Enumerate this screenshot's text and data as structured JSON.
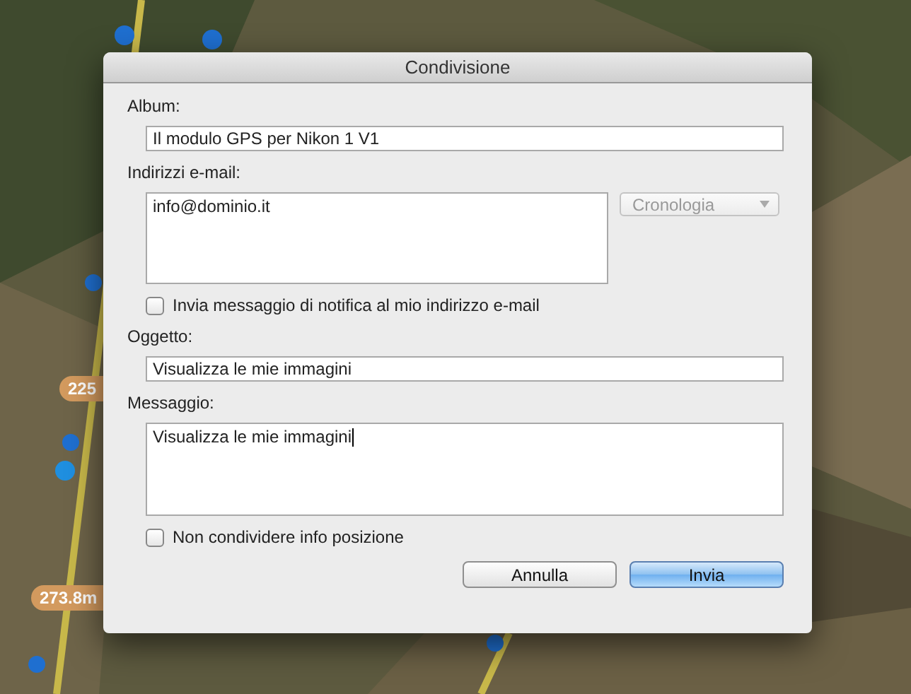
{
  "map": {
    "labels": [
      {
        "text": "225"
      },
      {
        "text": "273.8m"
      }
    ]
  },
  "dialog": {
    "title": "Condivisione",
    "sections": [
      {
        "kind": "line",
        "label": "Album:",
        "value": "Il modulo GPS per Nikon 1 V1",
        "focused": false
      },
      {
        "kind": "area",
        "label": "Indirizzi e-mail:",
        "value": "info@dominio.it",
        "focused": false,
        "dropdown": {
          "label": "Cronologia",
          "disabled": true
        }
      },
      {
        "kind": "checkbox",
        "label": "Invia messaggio di notifica al mio indirizzo e-mail",
        "checked": false
      },
      {
        "kind": "line",
        "label": "Oggetto:",
        "value": "Visualizza le mie immagini",
        "focused": false
      },
      {
        "kind": "area",
        "label": "Messaggio:",
        "value": "Visualizza le mie immagini",
        "focused": true
      },
      {
        "kind": "checkbox",
        "label": "Non condividere info posizione",
        "checked": false
      }
    ],
    "buttons": [
      {
        "label": "Annulla",
        "default": false
      },
      {
        "label": "Invia",
        "default": true
      }
    ]
  }
}
